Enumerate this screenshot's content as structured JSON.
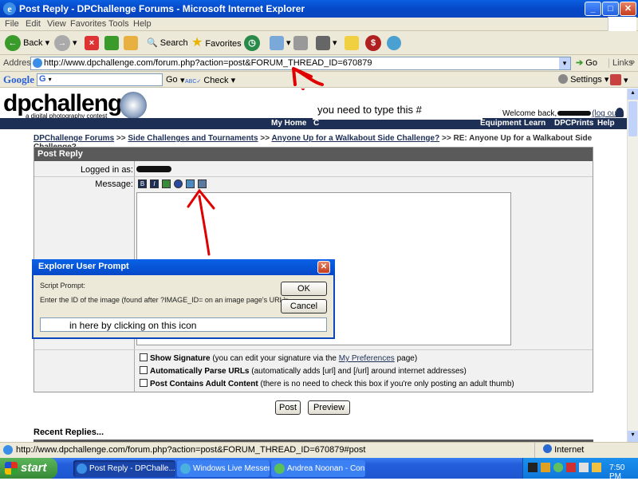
{
  "window": {
    "title": "Post Reply - DPChallenge Forums - Microsoft Internet Explorer"
  },
  "menu": [
    "File",
    "Edit",
    "View",
    "Favorites",
    "Tools",
    "Help"
  ],
  "toolbar": {
    "back": "Back",
    "search": "Search",
    "favorites": "Favorites"
  },
  "address": {
    "label": "Address",
    "url": "http://www.dpchallenge.com/forum.php?action=post&FORUM_THREAD_ID=670879",
    "go": "Go",
    "links": "Links"
  },
  "googlebar": {
    "logo": "Google",
    "go": "Go",
    "check": "Check",
    "settings": "Settings"
  },
  "site": {
    "logo": "dpchallenge",
    "tagline": "a digital photography contest",
    "welcome": "Welcome back,",
    "logout": "(log out)",
    "nav": [
      "My Home",
      "C",
      "Equipment",
      "Learn",
      "DPCPrints",
      "Help"
    ]
  },
  "breadcrumb": {
    "forums": "DPChallenge Forums",
    "sep1": " >> ",
    "side": "Side Challenges and Tournaments",
    "sep2": " >> ",
    "thread": "Anyone Up for a Walkabout Side Challenge?",
    "sep3": " >> ",
    "current": "RE: Anyone Up for a Walkabout Side Challenge?"
  },
  "form": {
    "header": "Post Reply",
    "logged_in_label": "Logged in as:",
    "message_label": "Message:",
    "format_buttons": [
      "B",
      "I",
      "",
      "",
      "",
      ""
    ],
    "options": [
      {
        "title": "Show Signature",
        "pre": " (you can edit your signature via the ",
        "link": "My Preferences",
        "post": " page)"
      },
      {
        "title": "Automatically Parse URLs",
        "pre": " (automatically adds [url] and [/url] around internet addresses)",
        "link": "",
        "post": ""
      },
      {
        "title": "Post Contains Adult Content",
        "pre": " (there is no need to check this box if you're only posting an adult thumb)",
        "link": "",
        "post": ""
      }
    ],
    "post_button": "Post",
    "preview_button": "Preview"
  },
  "recent": "Recent Replies...",
  "dialog": {
    "title": "Explorer User Prompt",
    "label": "Script Prompt:",
    "text": "Enter the ID of the image (found after ?IMAGE_ID= on an image page's URL):",
    "ok": "OK",
    "cancel": "Cancel",
    "annotation": "in here by clicking on this icon"
  },
  "annotation_top": "you need to  type this #",
  "statusbar": {
    "url": "http://www.dpchallenge.com/forum.php?action=post&FORUM_THREAD_ID=670879#post",
    "zone": "Internet"
  },
  "taskbar": {
    "start": "start",
    "tasks": [
      "Post Reply - DPChalle...",
      "Windows Live Messen...",
      "Andrea Noonan - Con..."
    ],
    "time": "7:50 PM"
  },
  "colors": {
    "nav": "#1d2f55",
    "annotation": "#e00000",
    "xp_blue": "#245edb"
  }
}
